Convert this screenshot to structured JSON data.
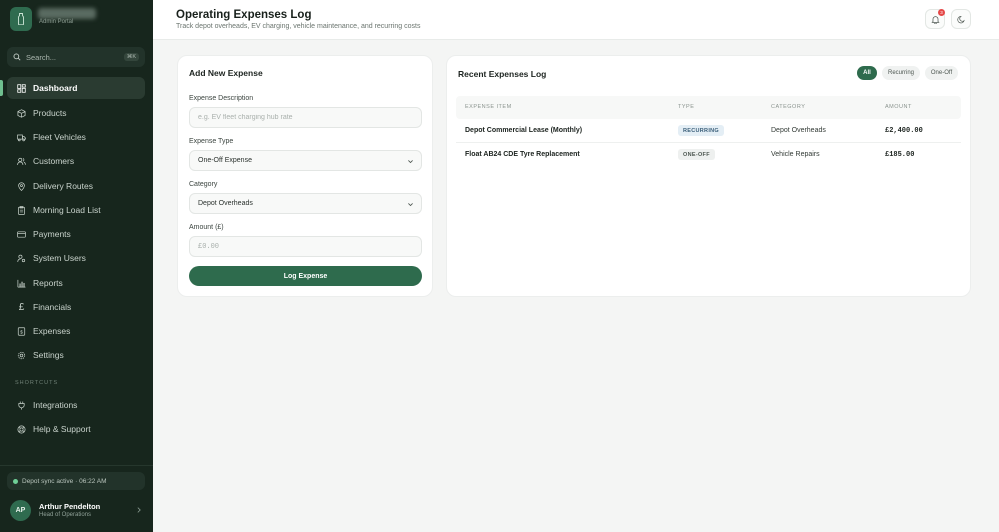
{
  "app": {
    "subtitle": "Admin Portal"
  },
  "search": {
    "placeholder": "Search...",
    "shortcut": "⌘K"
  },
  "sidebar": {
    "items": [
      {
        "label": "Dashboard",
        "icon": "grid-icon"
      },
      {
        "label": "Products",
        "icon": "box-icon"
      },
      {
        "label": "Fleet Vehicles",
        "icon": "truck-icon"
      },
      {
        "label": "Customers",
        "icon": "users-icon"
      },
      {
        "label": "Delivery Routes",
        "icon": "map-pin-icon"
      },
      {
        "label": "Morning Load List",
        "icon": "clipboard-icon"
      },
      {
        "label": "Payments",
        "icon": "credit-card-icon"
      },
      {
        "label": "System Users",
        "icon": "user-cog-icon"
      },
      {
        "label": "Reports",
        "icon": "bar-chart-icon"
      },
      {
        "label": "Financials",
        "icon": "pound-icon"
      },
      {
        "label": "Expenses",
        "icon": "receipt-icon"
      },
      {
        "label": "Settings",
        "icon": "gear-icon"
      }
    ],
    "shortcuts_label": "SHORTCUTS",
    "shortcuts": [
      {
        "label": "Integrations",
        "icon": "plug-icon"
      },
      {
        "label": "Help & Support",
        "icon": "lifebuoy-icon"
      }
    ],
    "sync_status": "Depot sync active · 06:22 AM",
    "user": {
      "initials": "AP",
      "name": "Arthur Pendelton",
      "role": "Head of Operations"
    }
  },
  "header": {
    "title": "Operating Expenses Log",
    "subtitle": "Track depot overheads, EV charging, vehicle maintenance, and recurring costs",
    "notification_count": "3"
  },
  "form": {
    "title": "Add New Expense",
    "description_label": "Expense Description",
    "description_placeholder": "e.g. EV fleet charging hub rate",
    "type_label": "Expense Type",
    "type_value": "One-Off Expense",
    "category_label": "Category",
    "category_value": "Depot Overheads",
    "amount_label": "Amount (£)",
    "amount_placeholder": "£0.00",
    "submit_label": "Log Expense"
  },
  "log": {
    "title": "Recent Expenses Log",
    "filters": [
      "All",
      "Recurring",
      "One-Off"
    ],
    "columns": [
      "EXPENSE ITEM",
      "TYPE",
      "CATEGORY",
      "AMOUNT"
    ],
    "rows": [
      {
        "item": "Depot Commercial Lease (Monthly)",
        "type": "RECURRING",
        "category": "Depot Overheads",
        "amount": "£2,400.00"
      },
      {
        "item": "Float AB24 CDE Tyre Replacement",
        "type": "ONE-OFF",
        "category": "Vehicle Repairs",
        "amount": "£185.00"
      }
    ]
  },
  "colors": {
    "sidebar_bg": "#17261d",
    "accent": "#2e6b4d",
    "recurring_badge": "#e4eef5",
    "notification_badge": "#e54848"
  }
}
